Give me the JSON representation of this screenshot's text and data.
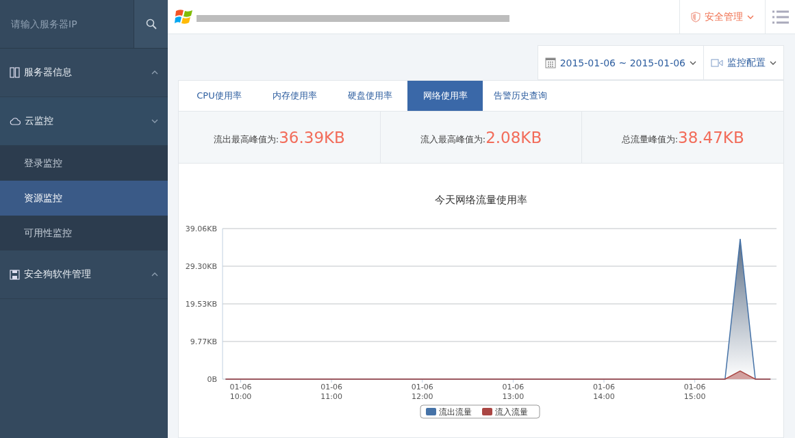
{
  "sidebar": {
    "search": {
      "placeholder": "请输入服务器IP"
    },
    "groups": [
      {
        "label": "服务器信息",
        "expanded": false
      },
      {
        "label": "云监控",
        "expanded": true,
        "children": [
          {
            "label": "登录监控",
            "selected": false
          },
          {
            "label": "资源监控",
            "selected": true
          },
          {
            "label": "可用性监控",
            "selected": false
          }
        ]
      },
      {
        "label": "安全狗软件管理",
        "expanded": false
      }
    ]
  },
  "header": {
    "security_menu": "安全管理"
  },
  "toolbar": {
    "date_range": "2015-01-06 ~ 2015-01-06",
    "config": "监控配置"
  },
  "tabs": [
    {
      "label": "CPU使用率",
      "selected": false
    },
    {
      "label": "内存使用率",
      "selected": false
    },
    {
      "label": "硬盘使用率",
      "selected": false
    },
    {
      "label": "网络使用率",
      "selected": true
    },
    {
      "label": "告警历史查询",
      "selected": false
    }
  ],
  "stats": [
    {
      "label": "流出最高峰值为:",
      "value": "36.39KB"
    },
    {
      "label": "流入最高峰值为:",
      "value": "2.08KB"
    },
    {
      "label": "总流量峰值为:",
      "value": "38.47KB"
    }
  ],
  "chart_data": {
    "type": "area",
    "title": "今天网络流量使用率",
    "categories": [
      null,
      "01-06 10:00",
      null,
      null,
      null,
      null,
      null,
      "01-06 11:00",
      null,
      null,
      null,
      null,
      null,
      "01-06 12:00",
      null,
      null,
      null,
      null,
      null,
      "01-06 13:00",
      null,
      null,
      null,
      null,
      null,
      "01-06 14:00",
      null,
      null,
      null,
      null,
      null,
      "01-06 15:00",
      null,
      null,
      null,
      null,
      null
    ],
    "series": [
      {
        "name": "流出流量",
        "color": "#4572a7",
        "values": [
          0,
          0,
          0,
          0,
          0,
          0,
          0,
          0,
          0,
          0,
          0,
          0,
          0,
          0,
          0,
          0,
          0,
          0,
          0,
          0,
          0,
          0,
          0,
          0,
          0,
          0,
          0,
          0,
          0,
          0,
          0,
          0,
          0,
          0,
          36.4,
          0,
          0
        ]
      },
      {
        "name": "流入流量",
        "color": "#aa4643",
        "values": [
          0,
          0,
          0,
          0,
          0,
          0,
          0,
          0,
          0,
          0,
          0,
          0,
          0,
          0,
          0,
          0,
          0,
          0,
          0,
          0,
          0,
          0,
          0,
          0,
          0,
          0,
          0,
          0,
          0,
          0,
          0,
          0,
          0,
          0,
          2.1,
          0,
          0
        ]
      }
    ],
    "ylim": [
      0,
      39.06
    ],
    "grid": true,
    "legend": "bottom",
    "yticks": [
      {
        "value": 0,
        "label": "0B"
      },
      {
        "value": 9.77,
        "label": "9.77KB"
      },
      {
        "value": 19.53,
        "label": "19.53KB"
      },
      {
        "value": 29.3,
        "label": "29.30KB"
      },
      {
        "value": 39.06,
        "label": "39.06KB"
      }
    ]
  }
}
